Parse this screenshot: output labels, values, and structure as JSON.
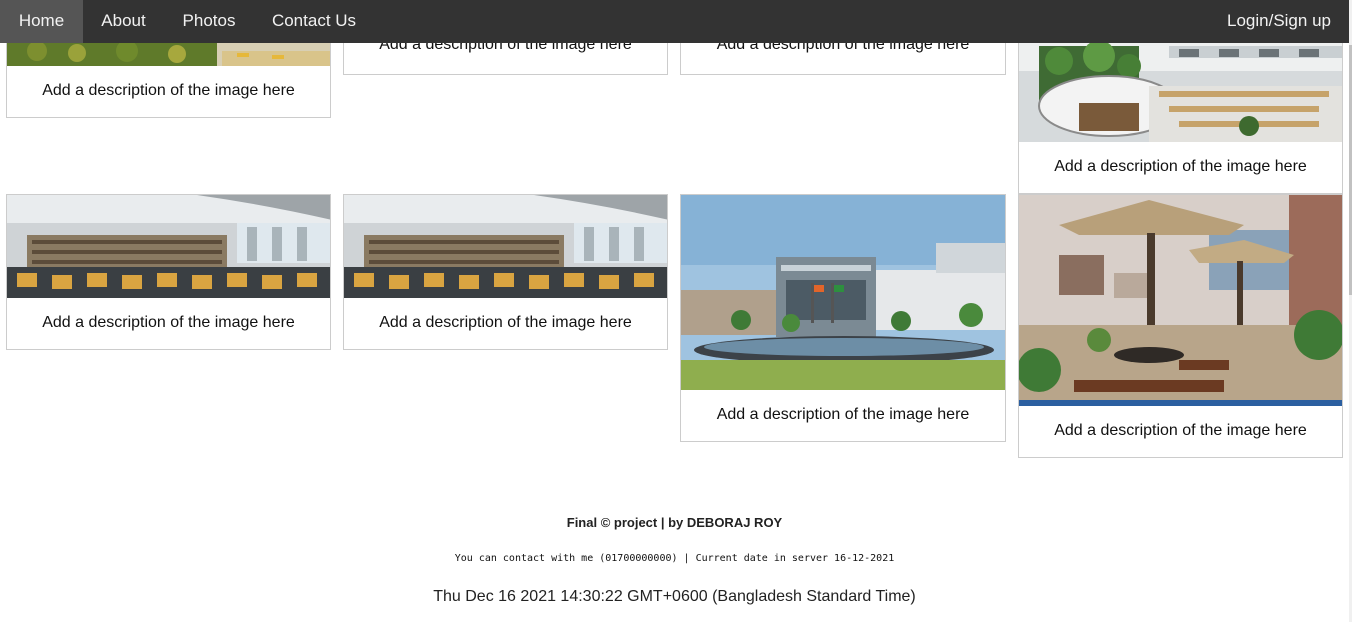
{
  "nav": {
    "items": [
      {
        "label": "Home",
        "active": true
      },
      {
        "label": "About"
      },
      {
        "label": "Photos"
      },
      {
        "label": "Contact Us"
      }
    ],
    "login_label": "Login/Sign up"
  },
  "gallery": {
    "cards": [
      {
        "description": "Add a description of the image here",
        "image": "garden-walkway-photo"
      },
      {
        "description": "Add a description of the image here"
      },
      {
        "description": "Add a description of the image here"
      },
      {
        "description": "Add a description of the image here",
        "image": "library-atrium-photo"
      },
      {
        "description": "Add a description of the image here",
        "image": "library-reading-hall-photo"
      },
      {
        "description": "Add a description of the image here",
        "image": "library-reading-hall-photo"
      },
      {
        "description": "Add a description of the image here",
        "image": "campus-building-fountain-photo"
      },
      {
        "description": "Add a description of the image here",
        "image": "rooftop-seating-area-photo"
      }
    ]
  },
  "footer": {
    "credit": "Final © project | by DEBORAJ ROY",
    "contact": "You can contact with me (01700000000) | Current date in server 16-12-2021",
    "datetime": "Thu Dec 16 2021 14:30:22 GMT+0600 (Bangladesh Standard Time)"
  },
  "colors": {
    "nav_bg": "#333333",
    "nav_active": "#555555",
    "card_border": "#cccccc"
  }
}
